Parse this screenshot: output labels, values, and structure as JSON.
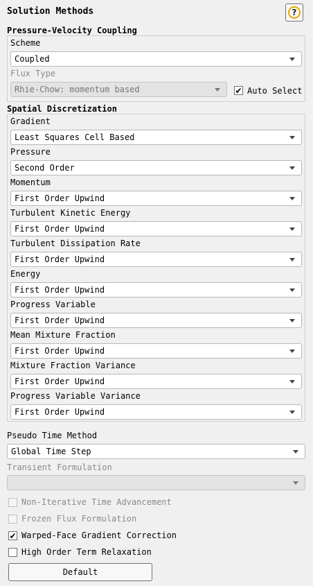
{
  "panel": {
    "title": "Solution Methods",
    "help_glyph": "?"
  },
  "pv_coupling": {
    "heading": "Pressure-Velocity Coupling",
    "scheme_label": "Scheme",
    "scheme_value": "Coupled",
    "flux_type_label": "Flux Type",
    "flux_type_value": "Rhie-Chow: momentum based",
    "auto_select_label": "Auto Select",
    "auto_select_checked": true
  },
  "spatial": {
    "heading": "Spatial Discretization",
    "rows": [
      {
        "label": "Gradient",
        "value": "Least Squares Cell Based"
      },
      {
        "label": "Pressure",
        "value": "Second Order"
      },
      {
        "label": "Momentum",
        "value": "First Order Upwind"
      },
      {
        "label": "Turbulent Kinetic Energy",
        "value": "First Order Upwind"
      },
      {
        "label": "Turbulent Dissipation Rate",
        "value": "First Order Upwind"
      },
      {
        "label": "Energy",
        "value": "First Order Upwind"
      },
      {
        "label": "Progress Variable",
        "value": "First Order Upwind"
      },
      {
        "label": "Mean Mixture Fraction",
        "value": "First Order Upwind"
      },
      {
        "label": "Mixture Fraction Variance",
        "value": "First Order Upwind"
      },
      {
        "label": "Progress Variable Variance",
        "value": "First Order Upwind"
      }
    ]
  },
  "pseudo_time": {
    "label": "Pseudo Time Method",
    "value": "Global Time Step"
  },
  "transient": {
    "label": "Transient Formulation",
    "value": ""
  },
  "options": [
    {
      "label": "Non-Iterative Time Advancement",
      "checked": false,
      "enabled": false
    },
    {
      "label": "Frozen Flux Formulation",
      "checked": false,
      "enabled": false
    },
    {
      "label": "Warped-Face Gradient Correction",
      "checked": true,
      "enabled": true
    },
    {
      "label": "High Order Term Relaxation",
      "checked": false,
      "enabled": true
    }
  ],
  "default_button": "Default",
  "check_glyph": "✔",
  "icons": {
    "help": "help-icon",
    "dropdown": "chevron-down-icon",
    "check": "checkmark-icon"
  },
  "colors": {
    "background": "#f0f0f0",
    "help_ring": "#e8a400",
    "disabled_text": "#8a8a8a"
  }
}
